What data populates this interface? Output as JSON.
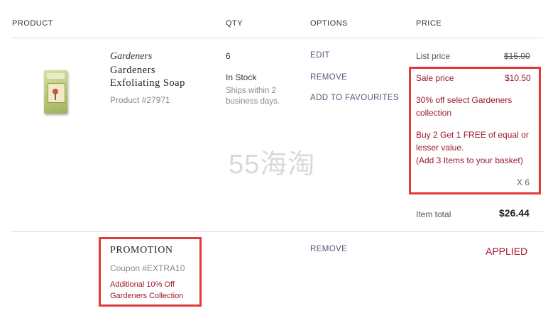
{
  "headers": {
    "product": "PRODUCT",
    "qty": "QTY",
    "options": "OPTIONS",
    "price": "PRICE"
  },
  "item": {
    "image_icon": "soap-product-image",
    "brand": "Gardeners",
    "name_line1": "Gardeners",
    "name_line2": "Exfoliating Soap",
    "product_number": "Product #27971",
    "qty": "6",
    "stock": "In Stock",
    "ships_line1": "Ships within 2",
    "ships_line2": "business days.",
    "edit_label": "EDIT",
    "remove_label": "REMOVE",
    "favourite_label": "ADD TO FAVOURITES",
    "list_price_label": "List price",
    "list_price": "$15.00",
    "sale_price_label": "Sale price",
    "sale_price": "$10.50",
    "promo_line1": "30% off select Gardeners",
    "promo_line2": "collection",
    "bogo_line1": "Buy 2 Get 1 FREE of equal or",
    "bogo_line2": "lesser value.",
    "bogo_line3": "(Add 3 Items to your basket)",
    "multiplier": "X 6",
    "item_total_label": "Item total",
    "item_total": "$26.44"
  },
  "promotion": {
    "title": "PROMOTION",
    "coupon": "Coupon #EXTRA10",
    "desc_line1": "Additional 10% Off",
    "desc_line2": "Gardeners Collection",
    "remove_label": "REMOVE",
    "status": "APPLIED"
  },
  "watermark": "55海淘",
  "colors": {
    "highlight_border": "#e03a3a",
    "promo_red": "#9b1b30",
    "link": "#555a7a"
  }
}
